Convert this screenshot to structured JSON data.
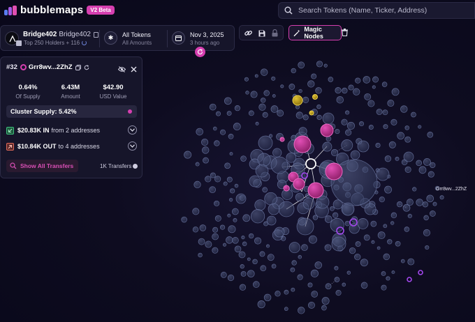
{
  "app": {
    "logo_text": "bubblemaps",
    "beta_badge": "V2 Beta",
    "brand_color": "#d63fb0"
  },
  "search": {
    "placeholder": "Search Tokens (Name, Ticker, Address)",
    "icon": "search-icon"
  },
  "token": {
    "name": "Bridge402",
    "ticker": "Bridge402",
    "subtitle": "Top 250 Holders + 116",
    "filter_title": "All Tokens",
    "filter_subtitle": "All Amounts",
    "date_title": "Nov 3, 2025",
    "date_subtitle": "3 hours ago"
  },
  "toolbar": {
    "magic_nodes_label": "Magic Nodes",
    "tools": [
      "link-icon",
      "save-icon",
      "lock-icon"
    ]
  },
  "panel": {
    "rank": "#32",
    "address": "Grr8wv...2ZhZ",
    "stats": [
      {
        "value": "0.64%",
        "label": "Of Supply"
      },
      {
        "value": "6.43M",
        "label": "Amount"
      },
      {
        "value": "$42.90",
        "label": "USD Value"
      }
    ],
    "cluster_supply": "Cluster Supply: 5.42%",
    "transfer_in": {
      "amount": "$20.83K IN",
      "detail": "from 2 addresses"
    },
    "transfer_out": {
      "amount": "$10.84K OUT",
      "detail": "to 4 addresses"
    },
    "show_transfers": "Show All Transfers",
    "transfers_count": "1K Transfers"
  },
  "map": {
    "selected_label": "Grr8wv...2ZhZ",
    "colors": {
      "neutral": "#3b4466",
      "cluster": "#c2368f",
      "purple": "#9a3fe0",
      "gold": "#c9a51a"
    }
  }
}
